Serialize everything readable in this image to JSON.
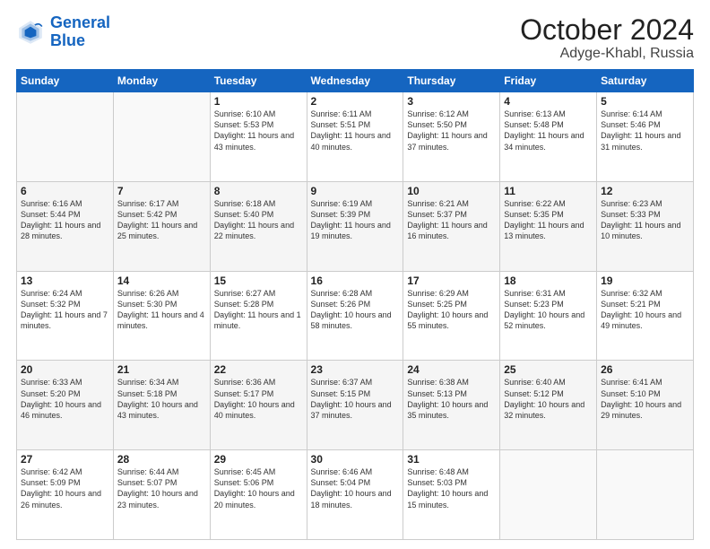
{
  "header": {
    "logo_line1": "General",
    "logo_line2": "Blue",
    "month": "October 2024",
    "location": "Adyge-Khabl, Russia"
  },
  "weekdays": [
    "Sunday",
    "Monday",
    "Tuesday",
    "Wednesday",
    "Thursday",
    "Friday",
    "Saturday"
  ],
  "weeks": [
    [
      {
        "day": "",
        "sunrise": "",
        "sunset": "",
        "daylight": ""
      },
      {
        "day": "",
        "sunrise": "",
        "sunset": "",
        "daylight": ""
      },
      {
        "day": "1",
        "sunrise": "Sunrise: 6:10 AM",
        "sunset": "Sunset: 5:53 PM",
        "daylight": "Daylight: 11 hours and 43 minutes."
      },
      {
        "day": "2",
        "sunrise": "Sunrise: 6:11 AM",
        "sunset": "Sunset: 5:51 PM",
        "daylight": "Daylight: 11 hours and 40 minutes."
      },
      {
        "day": "3",
        "sunrise": "Sunrise: 6:12 AM",
        "sunset": "Sunset: 5:50 PM",
        "daylight": "Daylight: 11 hours and 37 minutes."
      },
      {
        "day": "4",
        "sunrise": "Sunrise: 6:13 AM",
        "sunset": "Sunset: 5:48 PM",
        "daylight": "Daylight: 11 hours and 34 minutes."
      },
      {
        "day": "5",
        "sunrise": "Sunrise: 6:14 AM",
        "sunset": "Sunset: 5:46 PM",
        "daylight": "Daylight: 11 hours and 31 minutes."
      }
    ],
    [
      {
        "day": "6",
        "sunrise": "Sunrise: 6:16 AM",
        "sunset": "Sunset: 5:44 PM",
        "daylight": "Daylight: 11 hours and 28 minutes."
      },
      {
        "day": "7",
        "sunrise": "Sunrise: 6:17 AM",
        "sunset": "Sunset: 5:42 PM",
        "daylight": "Daylight: 11 hours and 25 minutes."
      },
      {
        "day": "8",
        "sunrise": "Sunrise: 6:18 AM",
        "sunset": "Sunset: 5:40 PM",
        "daylight": "Daylight: 11 hours and 22 minutes."
      },
      {
        "day": "9",
        "sunrise": "Sunrise: 6:19 AM",
        "sunset": "Sunset: 5:39 PM",
        "daylight": "Daylight: 11 hours and 19 minutes."
      },
      {
        "day": "10",
        "sunrise": "Sunrise: 6:21 AM",
        "sunset": "Sunset: 5:37 PM",
        "daylight": "Daylight: 11 hours and 16 minutes."
      },
      {
        "day": "11",
        "sunrise": "Sunrise: 6:22 AM",
        "sunset": "Sunset: 5:35 PM",
        "daylight": "Daylight: 11 hours and 13 minutes."
      },
      {
        "day": "12",
        "sunrise": "Sunrise: 6:23 AM",
        "sunset": "Sunset: 5:33 PM",
        "daylight": "Daylight: 11 hours and 10 minutes."
      }
    ],
    [
      {
        "day": "13",
        "sunrise": "Sunrise: 6:24 AM",
        "sunset": "Sunset: 5:32 PM",
        "daylight": "Daylight: 11 hours and 7 minutes."
      },
      {
        "day": "14",
        "sunrise": "Sunrise: 6:26 AM",
        "sunset": "Sunset: 5:30 PM",
        "daylight": "Daylight: 11 hours and 4 minutes."
      },
      {
        "day": "15",
        "sunrise": "Sunrise: 6:27 AM",
        "sunset": "Sunset: 5:28 PM",
        "daylight": "Daylight: 11 hours and 1 minute."
      },
      {
        "day": "16",
        "sunrise": "Sunrise: 6:28 AM",
        "sunset": "Sunset: 5:26 PM",
        "daylight": "Daylight: 10 hours and 58 minutes."
      },
      {
        "day": "17",
        "sunrise": "Sunrise: 6:29 AM",
        "sunset": "Sunset: 5:25 PM",
        "daylight": "Daylight: 10 hours and 55 minutes."
      },
      {
        "day": "18",
        "sunrise": "Sunrise: 6:31 AM",
        "sunset": "Sunset: 5:23 PM",
        "daylight": "Daylight: 10 hours and 52 minutes."
      },
      {
        "day": "19",
        "sunrise": "Sunrise: 6:32 AM",
        "sunset": "Sunset: 5:21 PM",
        "daylight": "Daylight: 10 hours and 49 minutes."
      }
    ],
    [
      {
        "day": "20",
        "sunrise": "Sunrise: 6:33 AM",
        "sunset": "Sunset: 5:20 PM",
        "daylight": "Daylight: 10 hours and 46 minutes."
      },
      {
        "day": "21",
        "sunrise": "Sunrise: 6:34 AM",
        "sunset": "Sunset: 5:18 PM",
        "daylight": "Daylight: 10 hours and 43 minutes."
      },
      {
        "day": "22",
        "sunrise": "Sunrise: 6:36 AM",
        "sunset": "Sunset: 5:17 PM",
        "daylight": "Daylight: 10 hours and 40 minutes."
      },
      {
        "day": "23",
        "sunrise": "Sunrise: 6:37 AM",
        "sunset": "Sunset: 5:15 PM",
        "daylight": "Daylight: 10 hours and 37 minutes."
      },
      {
        "day": "24",
        "sunrise": "Sunrise: 6:38 AM",
        "sunset": "Sunset: 5:13 PM",
        "daylight": "Daylight: 10 hours and 35 minutes."
      },
      {
        "day": "25",
        "sunrise": "Sunrise: 6:40 AM",
        "sunset": "Sunset: 5:12 PM",
        "daylight": "Daylight: 10 hours and 32 minutes."
      },
      {
        "day": "26",
        "sunrise": "Sunrise: 6:41 AM",
        "sunset": "Sunset: 5:10 PM",
        "daylight": "Daylight: 10 hours and 29 minutes."
      }
    ],
    [
      {
        "day": "27",
        "sunrise": "Sunrise: 6:42 AM",
        "sunset": "Sunset: 5:09 PM",
        "daylight": "Daylight: 10 hours and 26 minutes."
      },
      {
        "day": "28",
        "sunrise": "Sunrise: 6:44 AM",
        "sunset": "Sunset: 5:07 PM",
        "daylight": "Daylight: 10 hours and 23 minutes."
      },
      {
        "day": "29",
        "sunrise": "Sunrise: 6:45 AM",
        "sunset": "Sunset: 5:06 PM",
        "daylight": "Daylight: 10 hours and 20 minutes."
      },
      {
        "day": "30",
        "sunrise": "Sunrise: 6:46 AM",
        "sunset": "Sunset: 5:04 PM",
        "daylight": "Daylight: 10 hours and 18 minutes."
      },
      {
        "day": "31",
        "sunrise": "Sunrise: 6:48 AM",
        "sunset": "Sunset: 5:03 PM",
        "daylight": "Daylight: 10 hours and 15 minutes."
      },
      {
        "day": "",
        "sunrise": "",
        "sunset": "",
        "daylight": ""
      },
      {
        "day": "",
        "sunrise": "",
        "sunset": "",
        "daylight": ""
      }
    ]
  ]
}
